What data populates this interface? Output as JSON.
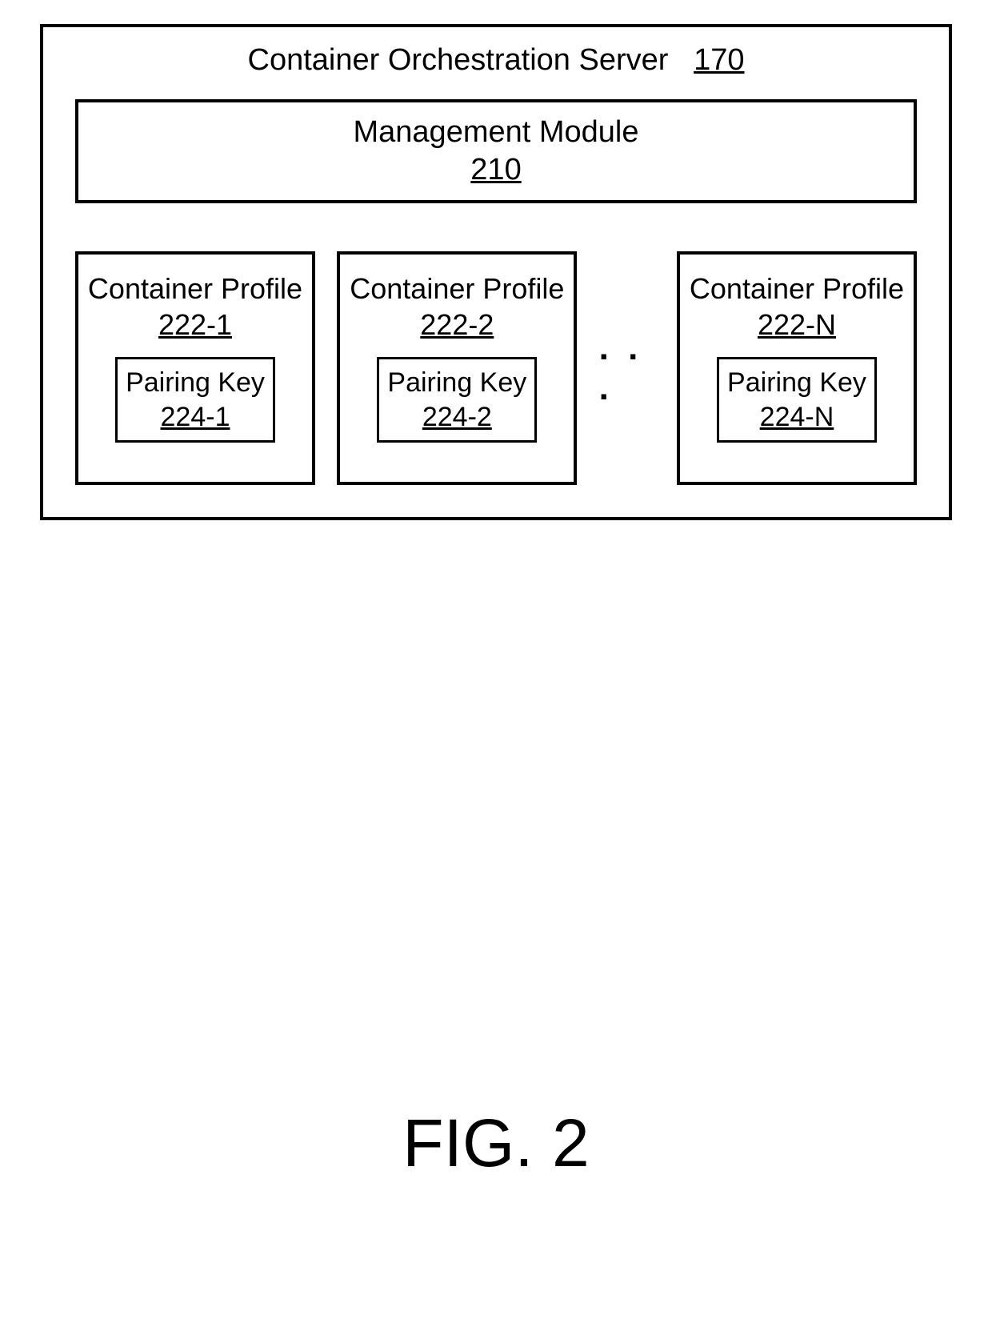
{
  "server": {
    "title_text": "Container Orchestration Server",
    "title_ref": "170"
  },
  "management": {
    "label": "Management Module",
    "ref": "210"
  },
  "profiles": [
    {
      "label": "Container Profile",
      "ref": "222-1",
      "pairing_label": "Pairing Key",
      "pairing_ref": "224-1"
    },
    {
      "label": "Container Profile",
      "ref": "222-2",
      "pairing_label": "Pairing Key",
      "pairing_ref": "224-2"
    },
    {
      "label": "Container Profile",
      "ref": "222-N",
      "pairing_label": "Pairing Key",
      "pairing_ref": "224-N"
    }
  ],
  "ellipsis": ". . .",
  "figure_label": "FIG. 2"
}
